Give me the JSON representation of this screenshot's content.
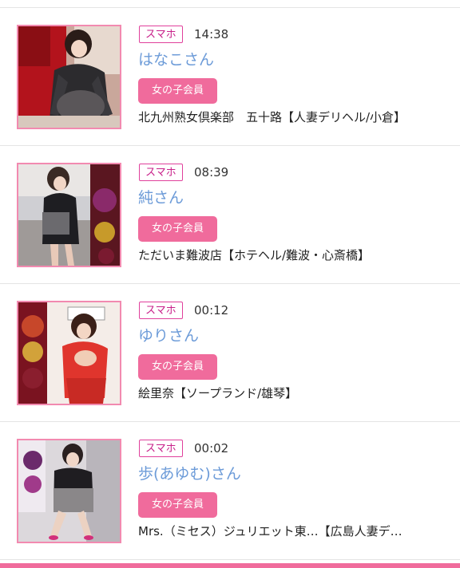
{
  "colors": {
    "accent_pink": "#f06b9c",
    "name_blue": "#6c9bd8",
    "device_magenta": "#c8208a",
    "thumb_border": "#f28ab0"
  },
  "entries": [
    {
      "device": "スマホ",
      "time": "14:38",
      "name": "はなこさん",
      "member_label": "女の子会員",
      "shop": "北九州熟女倶楽部　五十路【人妻デリヘル/小倉】",
      "thumb_icon": "profile-photo"
    },
    {
      "device": "スマホ",
      "time": "08:39",
      "name": "純さん",
      "member_label": "女の子会員",
      "shop": "ただいま難波店【ホテヘル/難波・心斎橋】",
      "thumb_icon": "profile-photo"
    },
    {
      "device": "スマホ",
      "time": "00:12",
      "name": "ゆりさん",
      "member_label": "女の子会員",
      "shop": "絵里奈【ソープランド/雄琴】",
      "thumb_icon": "profile-photo"
    },
    {
      "device": "スマホ",
      "time": "00:02",
      "name": "歩(あゆむ)さん",
      "member_label": "女の子会員",
      "shop": "Mrs.（ミセス）ジュリエット東…【広島人妻デ…",
      "thumb_icon": "profile-photo"
    }
  ]
}
